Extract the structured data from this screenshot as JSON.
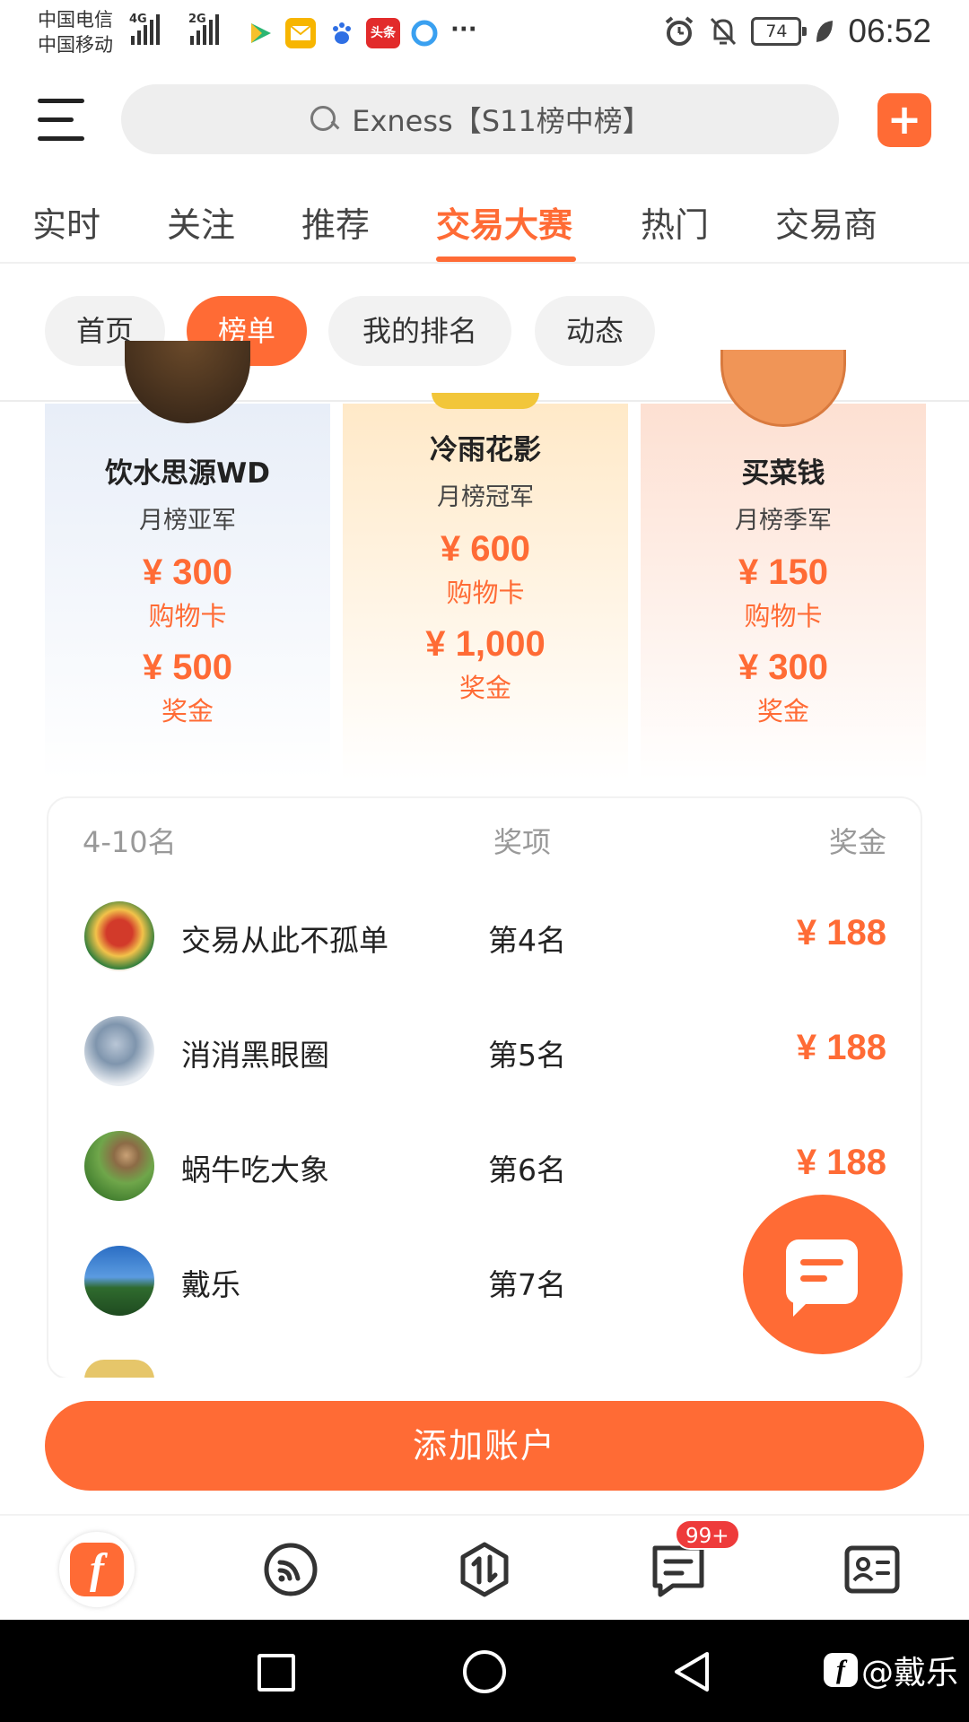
{
  "status_bar": {
    "carrier1": "中国电信",
    "carrier2": "中国移动",
    "net1": "4G",
    "net2": "2G",
    "app_icons": [
      "video-app-icon",
      "mail-app-icon",
      "baidu-app-icon",
      "toutiao-app-icon",
      "browser-app-icon"
    ],
    "toutiao_label": "头条",
    "more": "···",
    "battery": "74",
    "time": "06:52"
  },
  "header": {
    "search_query": "Exness【S11榜中榜】",
    "plus_label": "+"
  },
  "tabs": [
    {
      "label": "实时",
      "active": false
    },
    {
      "label": "关注",
      "active": false
    },
    {
      "label": "推荐",
      "active": false
    },
    {
      "label": "交易大赛",
      "active": true
    },
    {
      "label": "热门",
      "active": false
    },
    {
      "label": "交易商",
      "active": false
    }
  ],
  "chips": [
    {
      "label": "首页",
      "active": false
    },
    {
      "label": "榜单",
      "active": true
    },
    {
      "label": "我的排名",
      "active": false
    },
    {
      "label": "动态",
      "active": false
    }
  ],
  "podium": {
    "silver": {
      "name": "饮水思源WD",
      "title": "月榜亚军",
      "card_amount": "¥ 300",
      "card_label": "购物卡",
      "bonus_amount": "¥ 500",
      "bonus_label": "奖金"
    },
    "gold": {
      "name": "冷雨花影",
      "title": "月榜冠军",
      "card_amount": "¥ 600",
      "card_label": "购物卡",
      "bonus_amount": "¥ 1,000",
      "bonus_label": "奖金"
    },
    "bronze": {
      "name": "买菜钱",
      "title": "月榜季军",
      "card_amount": "¥ 150",
      "card_label": "购物卡",
      "bonus_amount": "¥ 300",
      "bonus_label": "奖金"
    }
  },
  "ranking_table": {
    "headers": {
      "range": "4-10名",
      "award": "奖项",
      "prize": "奖金"
    },
    "rows": [
      {
        "name": "交易从此不孤单",
        "rank": "第4名",
        "prize": "¥ 188"
      },
      {
        "name": "消消黑眼圈",
        "rank": "第5名",
        "prize": "¥ 188"
      },
      {
        "name": "蜗牛吃大象",
        "rank": "第6名",
        "prize": "¥ 188"
      },
      {
        "name": "戴乐",
        "rank": "第7名",
        "prize": ""
      }
    ]
  },
  "add_account_label": "添加账户",
  "bottom_nav": {
    "home_logo": "f",
    "messages_badge": "99+"
  },
  "watermark": {
    "logo": "f",
    "text": "@戴乐"
  },
  "colors": {
    "accent": "#ff6b35",
    "badge": "#ee3b3b"
  }
}
